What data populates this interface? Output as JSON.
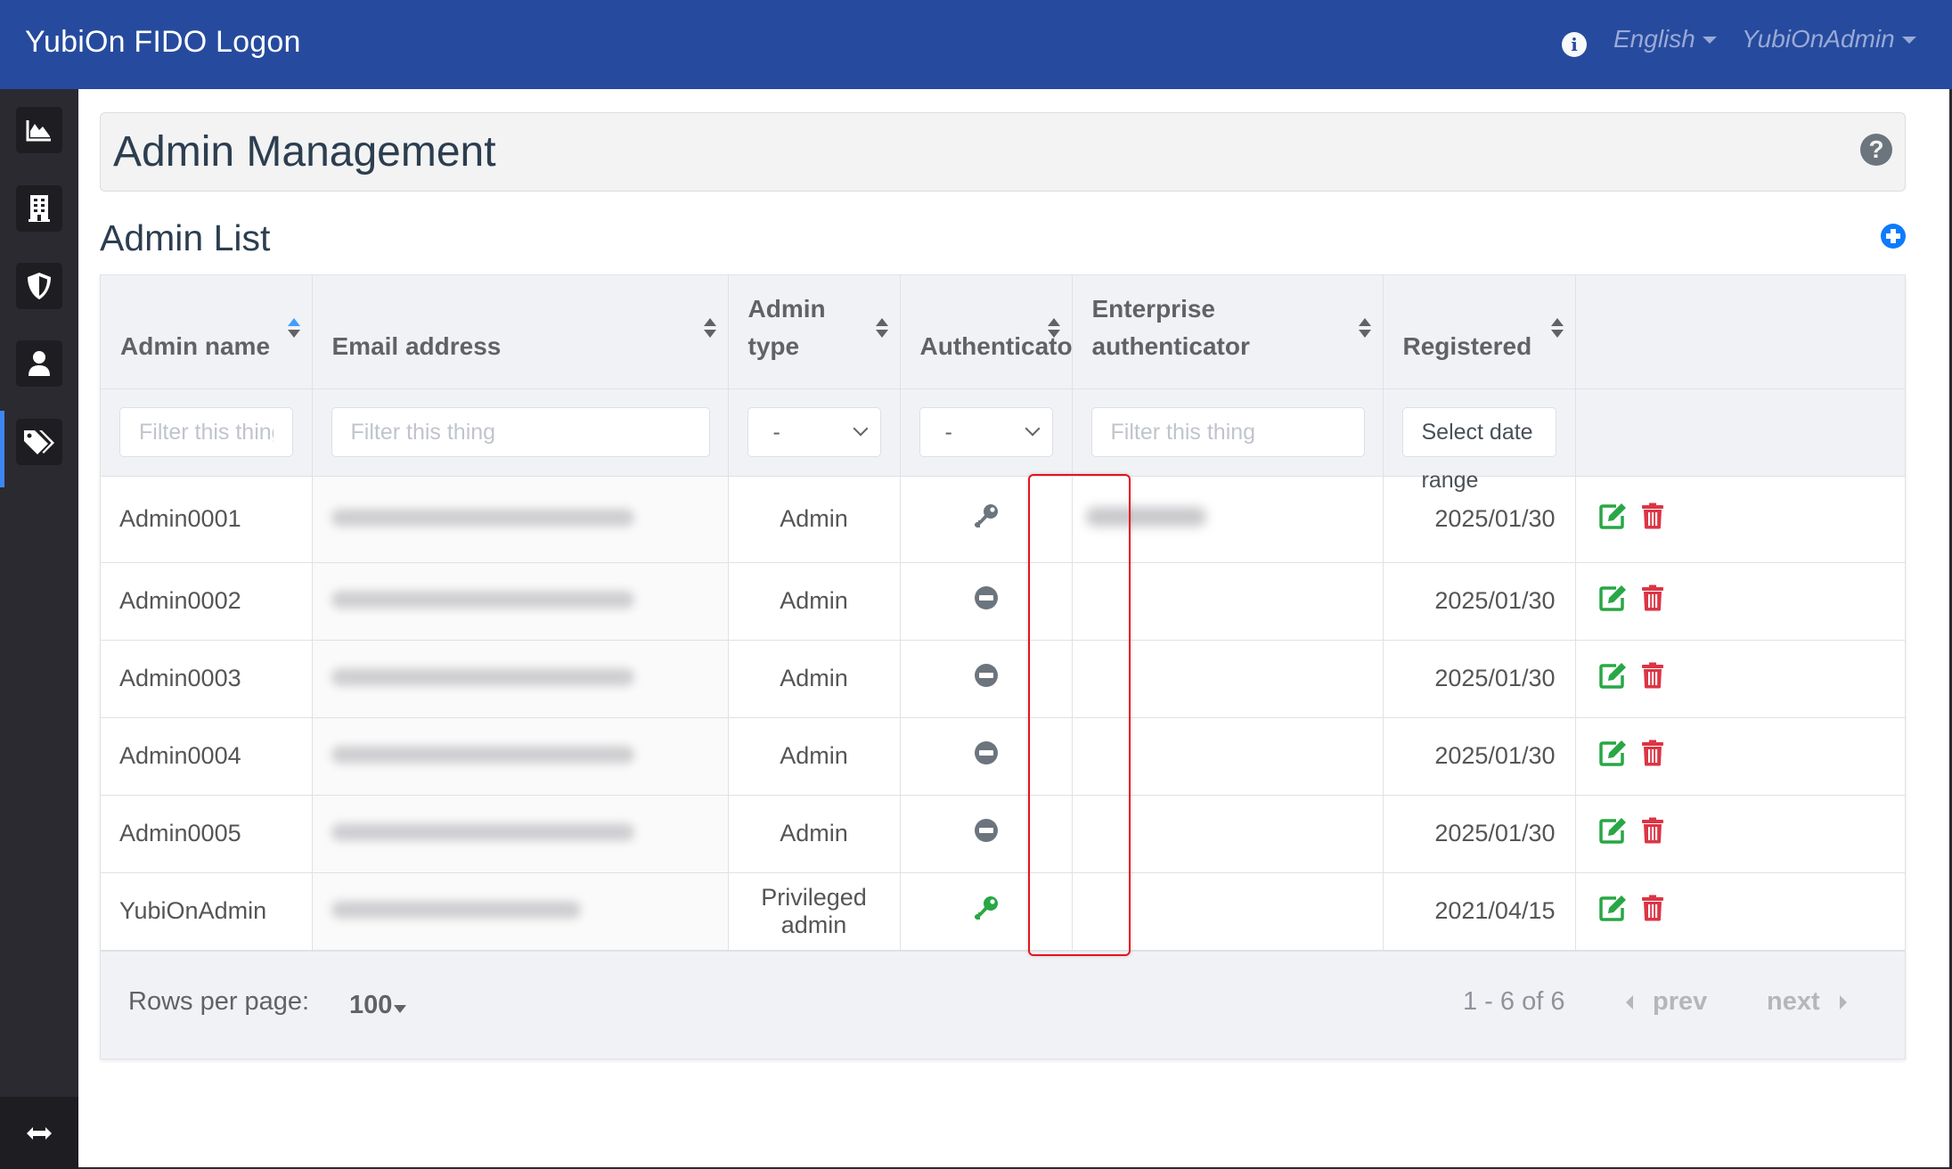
{
  "app": {
    "title": "YubiOn FIDO Logon",
    "nav": {
      "info_icon": "info-circle-icon",
      "language": "English",
      "user": "YubiOnAdmin"
    }
  },
  "sidebar": {
    "items": [
      {
        "id": "dashboard",
        "icon": "area-chart-icon",
        "active": false
      },
      {
        "id": "organization",
        "icon": "building-icon",
        "active": false
      },
      {
        "id": "security",
        "icon": "shield-icon",
        "active": false
      },
      {
        "id": "admins",
        "icon": "user-icon",
        "active": true
      },
      {
        "id": "licenses",
        "icon": "tags-icon",
        "active": false
      }
    ],
    "toggle_icon": "arrows-horizontal-icon"
  },
  "page": {
    "title": "Admin Management",
    "help_icon": "question-circle-icon",
    "section_title": "Admin List",
    "add_icon": "plus-circle-icon"
  },
  "table": {
    "columns": [
      {
        "label": "Admin name",
        "sorted": "asc"
      },
      {
        "label": "Email address"
      },
      {
        "label": "Admin type"
      },
      {
        "label": "Authenticator"
      },
      {
        "label": "Enterprise authenticator"
      },
      {
        "label": "Registered"
      },
      {
        "label": ""
      }
    ],
    "filters": {
      "admin_name_placeholder": "Filter this thing",
      "email_placeholder": "Filter this thing",
      "admin_type_value": "-",
      "authenticator_value": "-",
      "enterprise_placeholder": "Filter this thing",
      "registered_value": "Select date range"
    },
    "rows": [
      {
        "name": "Admin0001",
        "email": "(blurred)",
        "type": "Admin",
        "authenticator": "key-gray",
        "enterprise": "(blurred)",
        "registered": "2025/01/30"
      },
      {
        "name": "Admin0002",
        "email": "(blurred)",
        "type": "Admin",
        "authenticator": "minus-circle",
        "enterprise": "",
        "registered": "2025/01/30"
      },
      {
        "name": "Admin0003",
        "email": "(blurred)",
        "type": "Admin",
        "authenticator": "minus-circle",
        "enterprise": "",
        "registered": "2025/01/30"
      },
      {
        "name": "Admin0004",
        "email": "(blurred)",
        "type": "Admin",
        "authenticator": "minus-circle",
        "enterprise": "",
        "registered": "2025/01/30"
      },
      {
        "name": "Admin0005",
        "email": "(blurred)",
        "type": "Admin",
        "authenticator": "minus-circle",
        "enterprise": "",
        "registered": "2025/01/30"
      },
      {
        "name": "YubiOnAdmin",
        "email": "(blurred)",
        "type": "Privileged admin",
        "authenticator": "key-green",
        "enterprise": "",
        "registered": "2021/04/15"
      }
    ],
    "row_actions": {
      "edit_icon": "edit-icon",
      "delete_icon": "trash-icon"
    },
    "footer": {
      "rows_per_page_label": "Rows per page:",
      "rows_per_page_value": "100",
      "page_info": "1 - 6 of 6",
      "prev_label": "prev",
      "next_label": "next"
    }
  },
  "colors": {
    "navbar": "#264b9e",
    "sidebar": "#2b2a30",
    "active_indicator": "#3d86f2",
    "add_button": "#0d7bff",
    "edit": "#28a745",
    "delete": "#dc3545",
    "key_gray": "#6c757d",
    "key_green": "#28a745",
    "highlight": "#e8111b"
  }
}
